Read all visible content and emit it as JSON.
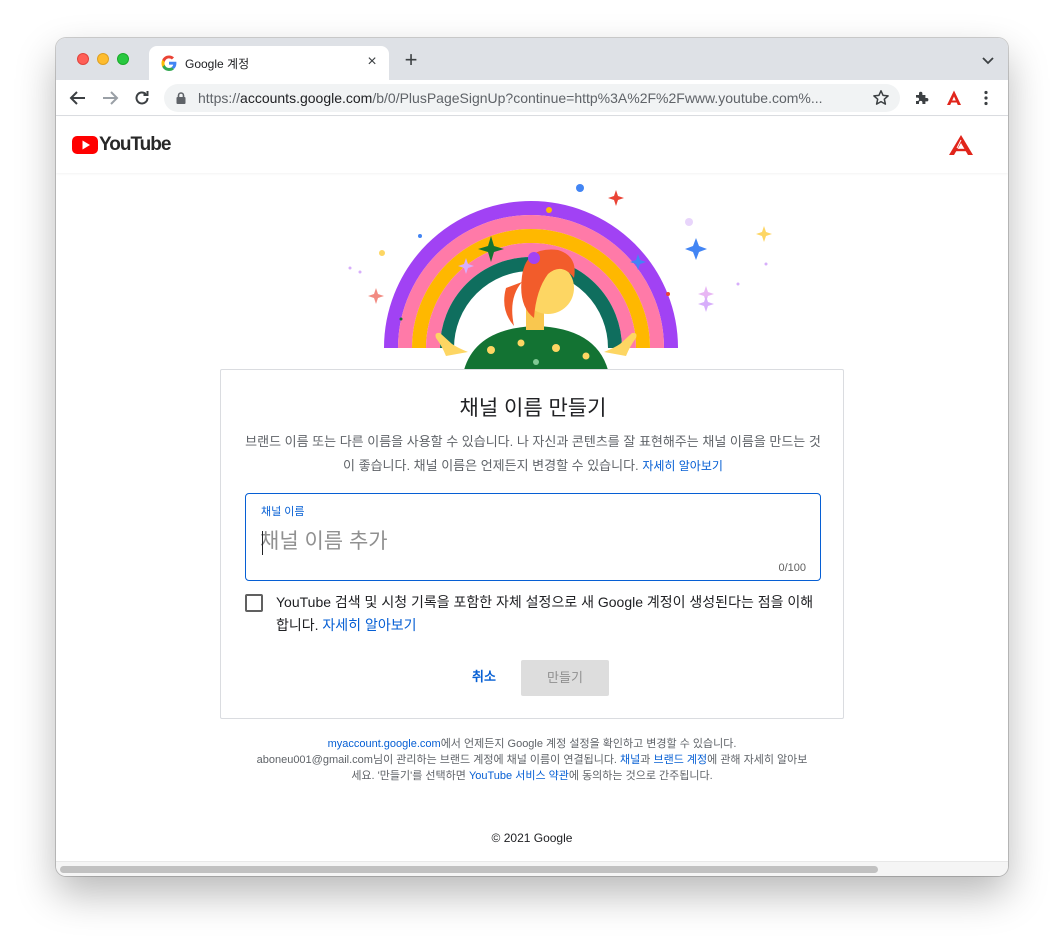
{
  "browser": {
    "tab_title": "Google 계정",
    "new_tab": "+",
    "tab_close": "×",
    "url_scheme": "https://",
    "url_host": "accounts.google.com",
    "url_path": "/b/0/PlusPageSignUp?continue=http%3A%2F%2Fwww.youtube.com%..."
  },
  "header": {
    "logo_text": "YouTube"
  },
  "card": {
    "title": "채널 이름 만들기",
    "description": "브랜드 이름 또는 다른 이름을 사용할 수 있습니다. 나 자신과 콘텐츠를 잘 표현해주는 채널 이름을 만드는 것이 좋습니다. 채널 이름은 언제든지 변경할 수 있습니다.",
    "learn_more": "자세히 알아보기",
    "field_label": "채널 이름",
    "field_placeholder": "채널 이름 추가",
    "field_value": "",
    "counter": "0/100",
    "checkbox_text": "YouTube 검색 및 시청 기록을 포함한 자체 설정으로 새 Google 계정이 생성된다는 점을 이해합니다.",
    "checkbox_checked": false,
    "checkbox_link": "자세히 알아보기",
    "cancel_label": "취소",
    "create_label": "만들기"
  },
  "footer": {
    "account_link": "myaccount.google.com",
    "line1_rest": "에서 언제든지 Google 계정 설정을 확인하고 변경할 수 있습니다.",
    "line2_a": "aboneu001@gmail.com님이 관리하는 브랜드 계정에 채널 이름이 연결됩니다. ",
    "channel_link": "채널",
    "line2_b": "과 ",
    "brand_link": "브랜드 계정",
    "line2_c": "에 관해 자세히 알아보세요. '만들기'를 선택하면 ",
    "tos_link": "YouTube 서비스 약관",
    "line2_d": "에 동의하는 것으로 간주됩니다.",
    "copyright": "© 2021 Google"
  },
  "colors": {
    "accent": "#065fd4",
    "youtube_red": "#ff0000",
    "disabled_button": "#dddddd"
  }
}
